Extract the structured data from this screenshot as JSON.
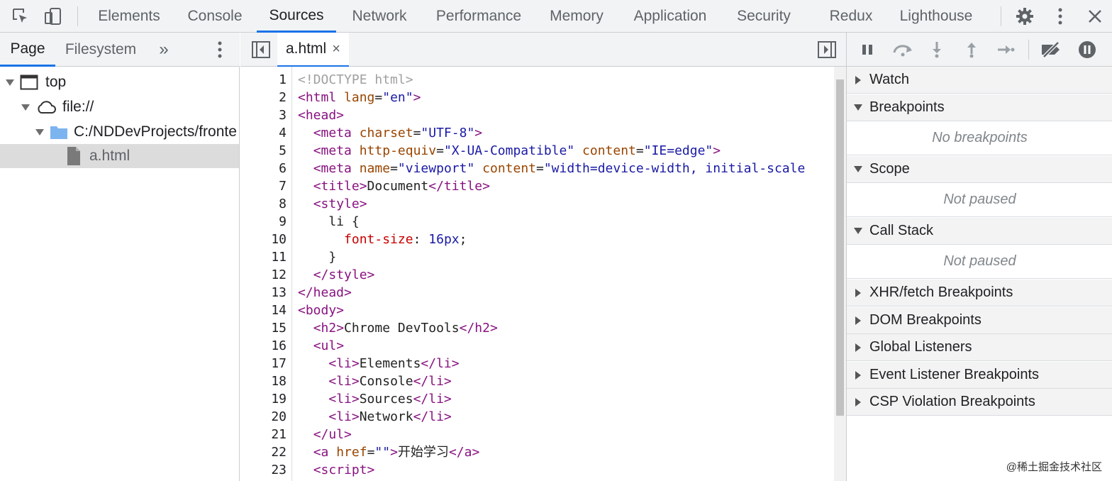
{
  "toolbar": {
    "tabs": [
      "Elements",
      "Console",
      "Sources",
      "Network",
      "Performance",
      "Memory",
      "Application",
      "Security",
      "Redux",
      "Lighthouse"
    ],
    "active_tab": "Sources",
    "icons": [
      "inspect-element-icon",
      "device-toolbar-icon",
      "settings-gear-icon",
      "more-vert-icon",
      "close-icon"
    ]
  },
  "navigator": {
    "tabs": [
      "Page",
      "Filesystem"
    ],
    "more": "»",
    "tree": [
      {
        "label": "top",
        "icon": "frame-window-icon"
      },
      {
        "label": "file://",
        "icon": "cloud-icon"
      },
      {
        "label": "C:/NDDevProjects/fronte",
        "icon": "folder-icon"
      },
      {
        "label": "a.html",
        "icon": "file-icon"
      }
    ]
  },
  "editor": {
    "file_tab": "a.html",
    "close_glyph": "×",
    "line_numbers": [
      "1",
      "2",
      "3",
      "4",
      "5",
      "6",
      "7",
      "8",
      "9",
      "10",
      "11",
      "12",
      "13",
      "14",
      "15",
      "16",
      "17",
      "18",
      "19",
      "20",
      "21",
      "22",
      "23"
    ],
    "lines": [
      [
        [
          "doc",
          "<!DOCTYPE html>"
        ]
      ],
      [
        [
          "tag",
          "<html "
        ],
        [
          "attr",
          "lang"
        ],
        [
          "txt",
          "="
        ],
        [
          "val",
          "\"en\""
        ],
        [
          "tag",
          ">"
        ]
      ],
      [
        [
          "tag",
          "<head>"
        ]
      ],
      [
        [
          "txt",
          "  "
        ],
        [
          "tag",
          "<meta "
        ],
        [
          "attr",
          "charset"
        ],
        [
          "txt",
          "="
        ],
        [
          "val",
          "\"UTF-8\""
        ],
        [
          "tag",
          ">"
        ]
      ],
      [
        [
          "txt",
          "  "
        ],
        [
          "tag",
          "<meta "
        ],
        [
          "attr",
          "http-equiv"
        ],
        [
          "txt",
          "="
        ],
        [
          "val",
          "\"X-UA-Compatible\""
        ],
        [
          "txt",
          " "
        ],
        [
          "attr",
          "content"
        ],
        [
          "txt",
          "="
        ],
        [
          "val",
          "\"IE=edge\""
        ],
        [
          "tag",
          ">"
        ]
      ],
      [
        [
          "txt",
          "  "
        ],
        [
          "tag",
          "<meta "
        ],
        [
          "attr",
          "name"
        ],
        [
          "txt",
          "="
        ],
        [
          "val",
          "\"viewport\""
        ],
        [
          "txt",
          " "
        ],
        [
          "attr",
          "content"
        ],
        [
          "txt",
          "="
        ],
        [
          "val",
          "\"width=device-width, initial-scale"
        ]
      ],
      [
        [
          "txt",
          "  "
        ],
        [
          "tag",
          "<title>"
        ],
        [
          "txt",
          "Document"
        ],
        [
          "tag",
          "</title>"
        ]
      ],
      [
        [
          "txt",
          "  "
        ],
        [
          "tag",
          "<style>"
        ]
      ],
      [
        [
          "txt",
          "    li {"
        ]
      ],
      [
        [
          "txt",
          "      "
        ],
        [
          "prop",
          "font-size"
        ],
        [
          "txt",
          ": "
        ],
        [
          "num",
          "16px"
        ],
        [
          "txt",
          ";"
        ]
      ],
      [
        [
          "txt",
          "    }"
        ]
      ],
      [
        [
          "txt",
          "  "
        ],
        [
          "tag",
          "</style>"
        ]
      ],
      [
        [
          "tag",
          "</head>"
        ]
      ],
      [
        [
          "tag",
          "<body>"
        ]
      ],
      [
        [
          "txt",
          "  "
        ],
        [
          "tag",
          "<h2>"
        ],
        [
          "txt",
          "Chrome DevTools"
        ],
        [
          "tag",
          "</h2>"
        ]
      ],
      [
        [
          "txt",
          "  "
        ],
        [
          "tag",
          "<ul>"
        ]
      ],
      [
        [
          "txt",
          "    "
        ],
        [
          "tag",
          "<li>"
        ],
        [
          "txt",
          "Elements"
        ],
        [
          "tag",
          "</li>"
        ]
      ],
      [
        [
          "txt",
          "    "
        ],
        [
          "tag",
          "<li>"
        ],
        [
          "txt",
          "Console"
        ],
        [
          "tag",
          "</li>"
        ]
      ],
      [
        [
          "txt",
          "    "
        ],
        [
          "tag",
          "<li>"
        ],
        [
          "txt",
          "Sources"
        ],
        [
          "tag",
          "</li>"
        ]
      ],
      [
        [
          "txt",
          "    "
        ],
        [
          "tag",
          "<li>"
        ],
        [
          "txt",
          "Network"
        ],
        [
          "tag",
          "</li>"
        ]
      ],
      [
        [
          "txt",
          "  "
        ],
        [
          "tag",
          "</ul>"
        ]
      ],
      [
        [
          "txt",
          "  "
        ],
        [
          "tag",
          "<a "
        ],
        [
          "attr",
          "href"
        ],
        [
          "txt",
          "="
        ],
        [
          "val",
          "\"\""
        ],
        [
          "tag",
          ">"
        ],
        [
          "txt",
          "开始学习"
        ],
        [
          "tag",
          "</a>"
        ]
      ],
      [
        [
          "txt",
          "  "
        ],
        [
          "tag",
          "<script>"
        ]
      ]
    ]
  },
  "debugger": {
    "controls": [
      "pause-icon",
      "step-over-icon",
      "step-into-icon",
      "step-out-icon",
      "step-icon",
      "deactivate-breakpoints-icon",
      "pause-on-exceptions-icon"
    ],
    "panes": [
      {
        "title": "Watch",
        "expanded": false,
        "body": ""
      },
      {
        "title": "Breakpoints",
        "expanded": true,
        "body": "No breakpoints"
      },
      {
        "title": "Scope",
        "expanded": true,
        "body": "Not paused"
      },
      {
        "title": "Call Stack",
        "expanded": true,
        "body": "Not paused"
      },
      {
        "title": "XHR/fetch Breakpoints",
        "expanded": false,
        "body": ""
      },
      {
        "title": "DOM Breakpoints",
        "expanded": false,
        "body": ""
      },
      {
        "title": "Global Listeners",
        "expanded": false,
        "body": ""
      },
      {
        "title": "Event Listener Breakpoints",
        "expanded": false,
        "body": ""
      },
      {
        "title": "CSP Violation Breakpoints",
        "expanded": false,
        "body": ""
      }
    ]
  },
  "watermark": "@稀土掘金技术社区",
  "colors": {
    "accent": "#1a73e8",
    "tag": "#881280",
    "attr": "#994500",
    "value": "#1a1aa6",
    "prop": "#c80000"
  }
}
